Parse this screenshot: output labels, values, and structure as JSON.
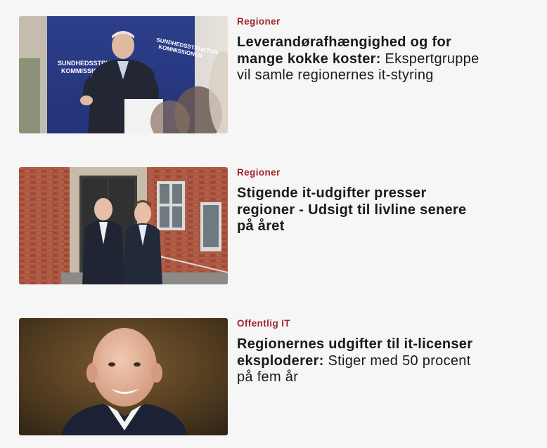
{
  "articles": [
    {
      "category": "Regioner",
      "headline_bold": "Leverandørafhængighed og for mange kokke koster:",
      "headline_rest": " Ekspertgruppe vil samle regionernes it-styring",
      "image": {
        "subject": "speaker-at-podium-photo",
        "backdrop_text_1": "SUNDHEDSSTRUKTUR-",
        "backdrop_text_2": "KOMMISSIONEN"
      }
    },
    {
      "category": "Regioner",
      "headline_bold": "Stigende it-udgifter presser regioner - Udsigt til livline senere på året",
      "headline_rest": "",
      "image": {
        "subject": "two-men-at-building-entrance-photo"
      }
    },
    {
      "category": "Offentlig IT",
      "headline_bold": "Regionernes udgifter til it-licenser eksploderer:",
      "headline_rest": " Stiger med 50 procent på fem år",
      "image": {
        "subject": "portrait-of-smiling-man-photo"
      }
    }
  ],
  "colors": {
    "category": "#a3232b",
    "headline": "#1a1a1a",
    "background": "#f6f6f6"
  }
}
